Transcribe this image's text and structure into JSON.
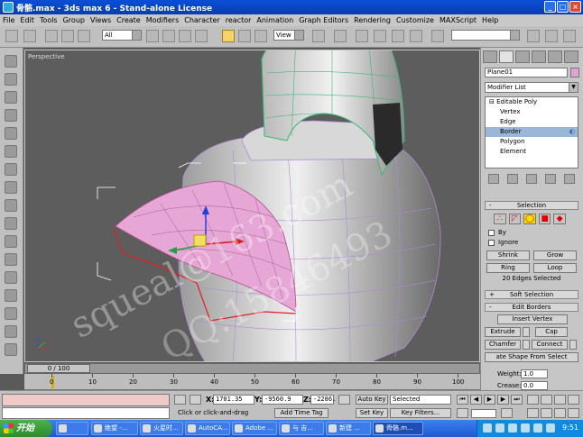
{
  "window": {
    "title": "骨骼.max - 3ds max 6 - Stand-alone License",
    "controls": [
      "_",
      "□",
      "×"
    ]
  },
  "menu": [
    "File",
    "Edit",
    "Tools",
    "Group",
    "Views",
    "Create",
    "Modifiers",
    "Character",
    "reactor",
    "Animation",
    "Graph Editors",
    "Rendering",
    "Customize",
    "MAXScript",
    "Help"
  ],
  "toolbar": {
    "selection_filter": "All",
    "ref_coord": "View"
  },
  "viewport": {
    "label": "Perspective",
    "watermark_1": "squeal@163.com",
    "watermark_2": "QQ:15846493"
  },
  "command_panel": {
    "object_name": "Plane01",
    "object_color": "#e3a3cf",
    "modifier_list": "Modifier List",
    "stack": {
      "head": "Editable Poly",
      "items": [
        "Vertex",
        "Edge",
        "Border",
        "Polygon",
        "Element"
      ],
      "selected": "Border"
    },
    "selection_rollout": {
      "title": "Selection",
      "by_label": "By",
      "ignore_label": "Ignore",
      "shrink": "Shrink",
      "grow": "Grow",
      "ring": "Ring",
      "loop": "Loop",
      "status": "20 Edges Selected"
    },
    "soft_selection_title": "Soft Selection",
    "edit_borders": {
      "title": "Edit Borders",
      "insert_vertex": "Insert Vertex",
      "extrude": "Extrude",
      "cap": "Cap",
      "chamfer": "Chamfer",
      "connect": "Connect",
      "create_shape": "ate Shape From Select",
      "weight_label": "Weight:",
      "weight_value": "1.0",
      "crease_label": "Crease:",
      "crease_value": "0.0"
    }
  },
  "timeline": {
    "frame_display": "0 / 100",
    "ticks": [
      "0",
      "10",
      "20",
      "30",
      "40",
      "50",
      "60",
      "70",
      "80",
      "90",
      "100"
    ]
  },
  "status": {
    "x_label": "X:",
    "x_value": "1701.35",
    "y_label": "Y:",
    "y_value": "-9560.9",
    "z_label": "Z:",
    "z_value": "-2286.",
    "auto_key": "Auto Key",
    "set_key": "Set Key",
    "key_mode": "Selected",
    "key_filters": "Key Filters...",
    "prompt": "Click or click-and-drag",
    "add_time_tag": "Add Time Tag"
  },
  "taskbar": {
    "start": "开始",
    "tasks": [
      "绝望 -...",
      "火星时...",
      "AutoCA...",
      "Adobe ...",
      "与 吉...",
      "新建 ...",
      "骨骼.m..."
    ],
    "active_task": "骨骼.m...",
    "clock": "9:51"
  }
}
